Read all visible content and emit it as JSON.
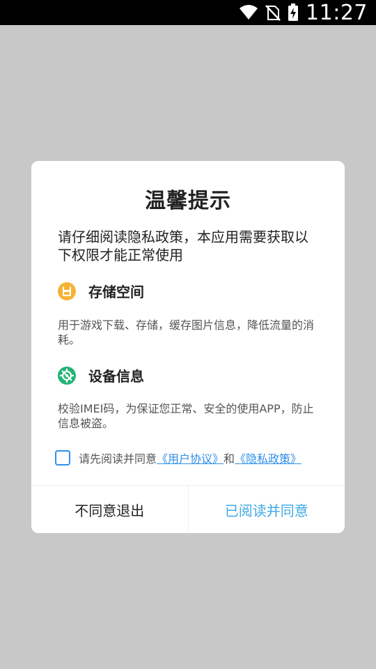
{
  "status_bar": {
    "time": "11:27",
    "icons": [
      "wifi-icon",
      "no-sim-icon",
      "battery-charging-icon"
    ]
  },
  "dialog": {
    "title": "温馨提示",
    "intro": "请仔细阅读隐私政策，本应用需要获取以下权限才能正常使用",
    "sections": [
      {
        "icon": "storage-icon",
        "icon_color": "#f5b335",
        "title": "存储空间",
        "description": "用于游戏下载、存储，缓存图片信息，降低流量的消耗。"
      },
      {
        "icon": "device-settings-icon",
        "icon_color": "#22b573",
        "title": "设备信息",
        "description": "校验IMEI码，为保证您正常、安全的使用APP，防止信息被盗。"
      }
    ],
    "agreement": {
      "checked": false,
      "prefix": "请先阅读并同意",
      "user_agreement_link": "《用户协议》",
      "conjunction": "和",
      "privacy_policy_link": "《隐私政策》"
    },
    "buttons": {
      "disagree": "不同意退出",
      "agree": "已阅读并同意"
    }
  },
  "colors": {
    "link": "#2f8fe8",
    "agree_button": "#3fa9e4",
    "overlay": "#c8c8c8"
  }
}
